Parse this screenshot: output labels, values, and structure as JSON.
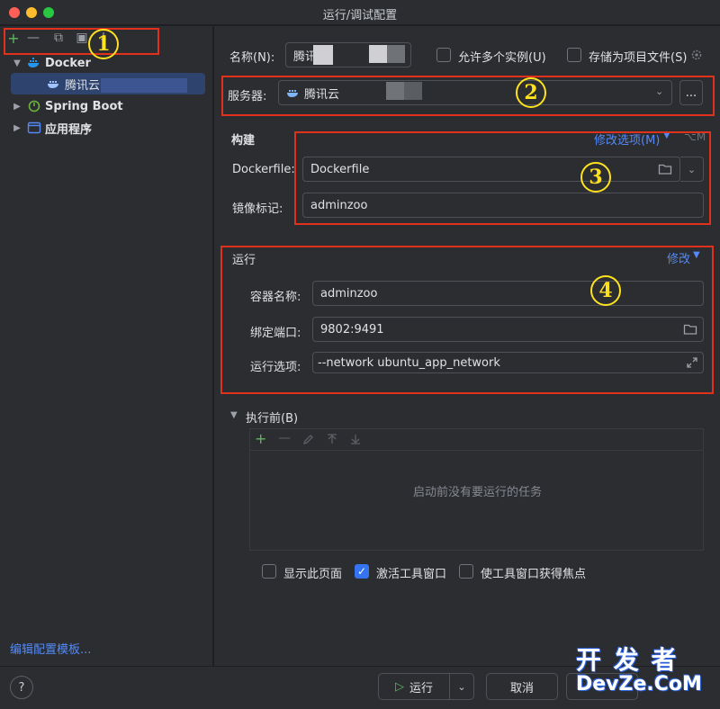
{
  "window": {
    "title": "运行/调试配置"
  },
  "toolbar": {
    "add": "+",
    "remove": "—",
    "copy": "⧉",
    "folder": "▣",
    "sort": "↓"
  },
  "tree": {
    "docker": {
      "label": "Docker"
    },
    "tencent": {
      "label": "腾讯云"
    },
    "springboot": {
      "label": "Spring Boot"
    },
    "app": {
      "label": "应用程序"
    }
  },
  "left_footer": {
    "edit_templates": "编辑配置模板..."
  },
  "form": {
    "name_label": "名称(N):",
    "name_value": "腾讯",
    "allow_multiple": "允许多个实例(U)",
    "store_as_file": "存储为项目文件(S)",
    "server_label": "服务器:",
    "server_value": "腾讯云",
    "server_more": "...",
    "build_header": "构建",
    "modify_options": "修改选项(M)",
    "modify_shortcut": "⌥M",
    "dockerfile_label": "Dockerfile:",
    "dockerfile_value": "Dockerfile",
    "image_tag_label": "镜像标记:",
    "image_tag_value": "adminzoo",
    "run_header": "运行",
    "modify_link": "修改",
    "container_name_label": "容器名称:",
    "container_name_value": "adminzoo",
    "bind_ports_label": "绑定端口:",
    "bind_ports_value": "9802:9491",
    "run_options_label": "运行选项:",
    "run_options_value": "--network ubuntu_app_network",
    "before_launch_header": "执行前(B)",
    "before_launch_empty": "启动前没有要运行的任务",
    "show_page": "显示此页面",
    "activate_tool_window": "激活工具窗口",
    "focus_tool_window": "使工具窗口获得焦点"
  },
  "annotations": {
    "n1": "1",
    "n2": "2",
    "n3": "3",
    "n4": "4"
  },
  "footer": {
    "help": "?",
    "run": "运行",
    "cancel": "取消"
  },
  "watermark": {
    "line1": "开 发 者",
    "line2": "DevZe.CoM"
  },
  "colors": {
    "accent": "#3574f0",
    "link": "#548af7",
    "annotation_red": "#e0311c",
    "annotation_yellow": "#ffe21f"
  }
}
